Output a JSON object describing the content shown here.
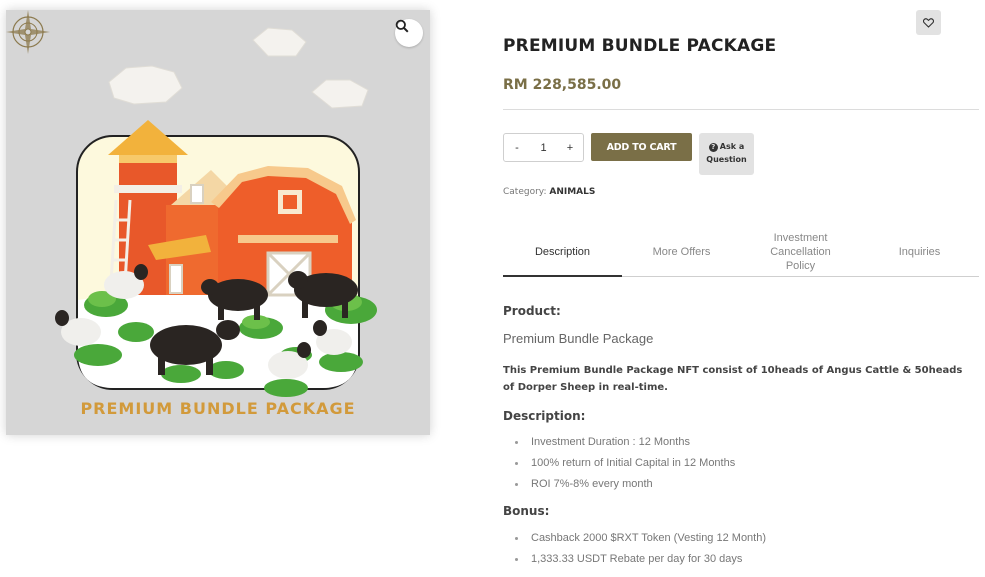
{
  "product": {
    "image_caption": "PREMIUM BUNDLE PACKAGE",
    "title": "PREMIUM BUNDLE PACKAGE",
    "price": "RM 228,585.00",
    "quantity": {
      "minus": "-",
      "value": "1",
      "plus": "+"
    },
    "add_to_cart_label": "ADD TO CART",
    "ask_question": {
      "line1": "Ask a",
      "line2": "Question"
    },
    "category": {
      "label": "Category:",
      "value": "ANIMALS"
    }
  },
  "tabs": [
    {
      "label": "Description",
      "active": true
    },
    {
      "label": "More Offers",
      "active": false
    },
    {
      "label": "Investment Cancellation Policy",
      "active": false
    },
    {
      "label": "Inquiries",
      "active": false
    }
  ],
  "description": {
    "product_heading": "Product:",
    "product_name": "Premium Bundle Package",
    "paragraph": "This Premium Bundle Package NFT consist of 10heads of Angus Cattle & 50heads of Dorper Sheep in real-time.",
    "description_heading": "Description:",
    "description_items": [
      "Investment Duration : 12 Months",
      "100% return of Initial Capital in 12 Months",
      "ROI 7%-8% every month"
    ],
    "bonus_heading": "Bonus:",
    "bonus_items": [
      "Cashback 2000 $RXT Token (Vesting 12 Month)",
      "1,333.33 USDT Rebate per day for 30 days"
    ]
  },
  "icons": {
    "zoom": "magnifier-icon",
    "wishlist": "heart-icon",
    "ask": "question-circle-icon",
    "logo": "compass-rose-logo"
  },
  "colors": {
    "accent": "#7a6f47",
    "caption": "#d29a3b",
    "image_bg": "#d6d6d6"
  }
}
